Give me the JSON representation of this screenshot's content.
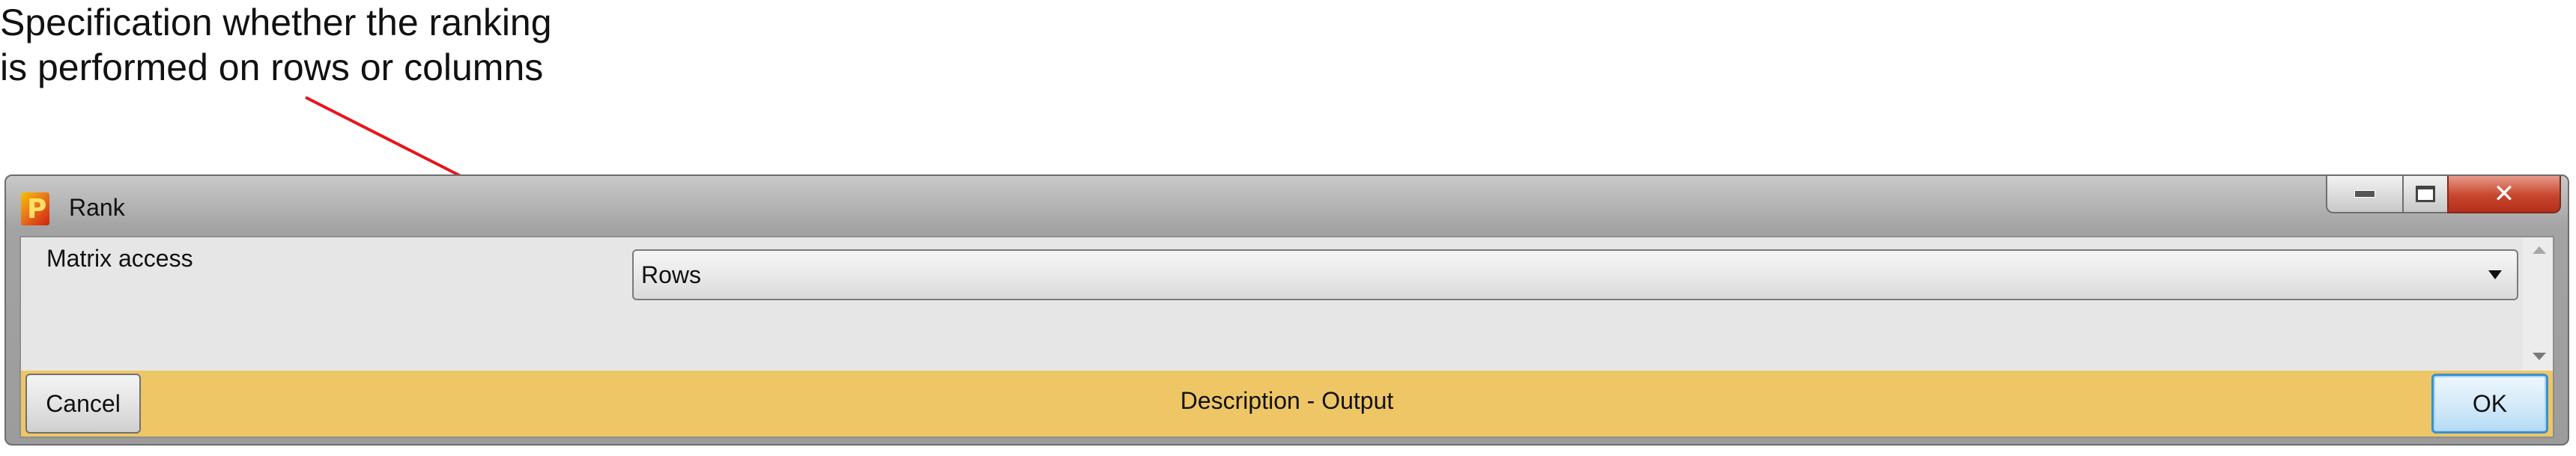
{
  "annotation": {
    "line1": "Specification whether the ranking",
    "line2": "is performed on rows or columns",
    "arrow_color": "#e8141b"
  },
  "window": {
    "title": "Rank",
    "icon": "app-logo-icon",
    "controls": [
      "minimize-icon",
      "maximize-icon",
      "close-icon"
    ]
  },
  "form": {
    "matrix_access_label": "Matrix access",
    "matrix_access_value": "Rows"
  },
  "footer": {
    "cancel_label": "Cancel",
    "description": "Description - Output",
    "ok_label": "OK",
    "background": "#eec665"
  }
}
